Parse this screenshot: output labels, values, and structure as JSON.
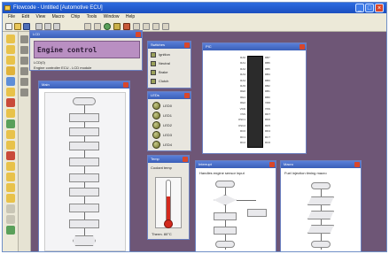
{
  "app": {
    "title": "Flowcode - Untitled [Automotive ECU]"
  },
  "menu": [
    "File",
    "Edit",
    "View",
    "Macro",
    "Chip",
    "Tools",
    "Window",
    "Help"
  ],
  "lcd": {
    "title": "LCD",
    "line1": "Engine control",
    "status": "LCD(0)",
    "footer": "Engine controller ECU - LCD module"
  },
  "switches": {
    "title": "Switches",
    "items": [
      "Ignition",
      "Neutral",
      "Brake",
      "Clutch"
    ]
  },
  "leds": {
    "title": "LEDs",
    "items": [
      "LED0",
      "LED1",
      "LED2",
      "LED3",
      "LED4"
    ]
  },
  "thermo": {
    "title": "Temp",
    "label": "Coolant temp",
    "reading": "Therm. 80°C"
  },
  "main_flow": {
    "title": "Main"
  },
  "chip": {
    "title": "PIC",
    "left_pins": [
      "RA0",
      "RA1",
      "RA2",
      "RA3",
      "RA4",
      "RA5",
      "RE0",
      "RE1",
      "RE2",
      "VDD",
      "VSS",
      "OSC1",
      "OSC2",
      "RC0",
      "RC1",
      "RC2"
    ],
    "right_pins": [
      "RB7",
      "RB6",
      "RB5",
      "RB4",
      "RB3",
      "RB2",
      "RB1",
      "RB0",
      "VDD",
      "VSS",
      "RD7",
      "RD6",
      "RD5",
      "RD4",
      "RC7",
      "RC6"
    ]
  },
  "flow_sub": {
    "title": "Interrupt",
    "caption": "Handles engine sensor input"
  },
  "flow_right": {
    "title": "Macro",
    "caption": "Fuel injection timing macro"
  },
  "colors": {
    "titlebar": "#2462d4",
    "workspace": "#6e5676",
    "lcd_bg": "#b98fc2"
  }
}
